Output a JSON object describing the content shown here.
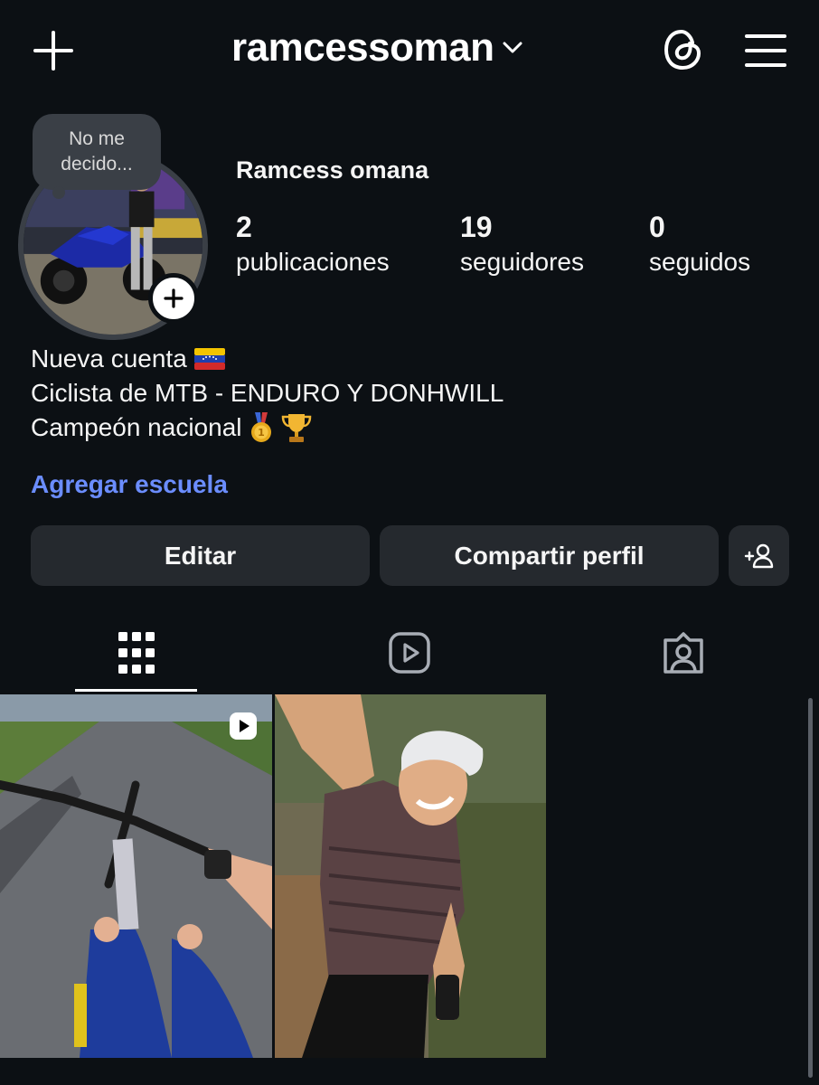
{
  "header": {
    "username": "ramcessoman",
    "icons": {
      "new_post": "plus-icon",
      "account_switch": "chevron-down-icon",
      "threads": "threads-icon",
      "menu": "hamburger-menu-icon"
    }
  },
  "profile": {
    "note": "No me decido...",
    "full_name": "Ramcess omana",
    "stats": [
      {
        "value": "2",
        "label": "publicaciones"
      },
      {
        "value": "19",
        "label": "seguidores"
      },
      {
        "value": "0",
        "label": "seguidos"
      }
    ],
    "bio": [
      {
        "text": "Nueva cuenta",
        "emoji": "venezuela-flag"
      },
      {
        "text": "Ciclista de MTB - ENDURO Y DONHWILL"
      },
      {
        "text": "Campeón nacional",
        "emoji": [
          "gold-medal",
          "trophy"
        ]
      }
    ],
    "add_school": "Agregar escuela"
  },
  "actions": {
    "edit": "Editar",
    "share": "Compartir perfil",
    "discover_people_icon": "add-person-icon"
  },
  "tabs": [
    {
      "icon": "grid-icon",
      "active": true
    },
    {
      "icon": "reels-icon",
      "active": false
    },
    {
      "icon": "tagged-icon",
      "active": false
    }
  ],
  "posts": [
    {
      "type": "reel",
      "description_icon": "reel-badge-icon"
    },
    {
      "type": "photo"
    }
  ],
  "colors": {
    "background": "#0c1014",
    "button": "#25292e",
    "link": "#6b8dff"
  }
}
